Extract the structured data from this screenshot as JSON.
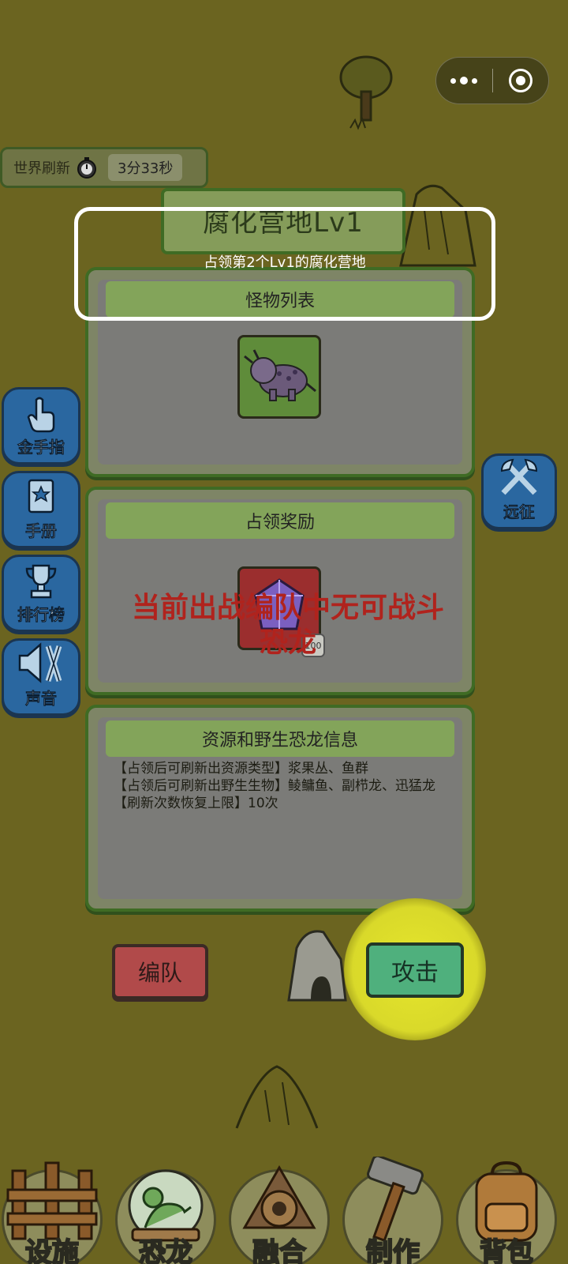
{
  "capsule": {
    "more_icon": "more-dots-icon",
    "close_icon": "target-circle-icon"
  },
  "world_refresh": {
    "label": "世界刷新",
    "timer": "3分33秒",
    "icon": "stopwatch-icon"
  },
  "side_menu": {
    "items": [
      {
        "label": "金手指",
        "icon": "pointing-finger-icon"
      },
      {
        "label": "手册",
        "icon": "book-star-icon"
      },
      {
        "label": "排行榜",
        "icon": "trophy-icon"
      },
      {
        "label": "声音",
        "icon": "speaker-muted-icon"
      }
    ],
    "right": {
      "label": "远征",
      "icon": "crossed-axes-icon"
    }
  },
  "camp": {
    "title": "腐化营地Lv1",
    "subtitle": "占领第2个Lv1的腐化营地"
  },
  "monsters": {
    "header": "怪物列表",
    "icon": "purple-triceratops-icon"
  },
  "rewards": {
    "header": "占领奖励",
    "item_icon": "purple-crystal-icon",
    "item_count": "100"
  },
  "warning": "当前出战编队中无可战斗恐龙",
  "resources": {
    "header": "资源和野生恐龙信息",
    "lines": [
      "【占领后可刷新出资源类型】浆果丛、鱼群",
      "【占领后可刷新出野生生物】鲮鳙鱼、副栉龙、迅猛龙",
      "【刷新次数恢复上限】10次"
    ]
  },
  "actions": {
    "team": "编队",
    "attack": "攻击"
  },
  "bottom_nav": [
    {
      "label": "设施",
      "icon": "wooden-fence-icon"
    },
    {
      "label": "恐龙",
      "icon": "dinosaur-terrarium-icon"
    },
    {
      "label": "融合",
      "icon": "fusion-emblem-icon"
    },
    {
      "label": "制作",
      "icon": "hammer-icon"
    },
    {
      "label": "背包",
      "icon": "backpack-icon"
    }
  ],
  "colors": {
    "background": "#6b6420",
    "panel_border": "#3f6b24",
    "warning_red": "#b0231d",
    "attack_green": "#4fb07d",
    "team_red": "#b14a4a",
    "highlight_yellow": "#e6e62c"
  }
}
